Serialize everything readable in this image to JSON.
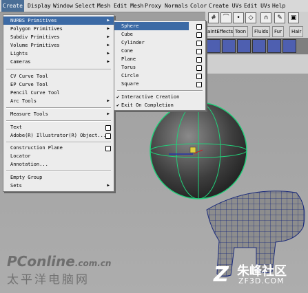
{
  "menubar": {
    "items": [
      "Create",
      "Display",
      "Window",
      "Select",
      "Mesh",
      "Edit Mesh",
      "Proxy",
      "Normals",
      "Color",
      "Create UVs",
      "Edit UVs",
      "Help"
    ]
  },
  "create_menu": {
    "items": [
      {
        "label": "NURBS Primitives",
        "arrow": true
      },
      {
        "label": "Polygon Primitives",
        "arrow": true
      },
      {
        "label": "Subdiv Primitives",
        "arrow": true
      },
      {
        "label": "Volume Primitives",
        "arrow": true
      },
      {
        "label": "Lights",
        "arrow": true
      },
      {
        "label": "Cameras",
        "arrow": true
      },
      {
        "label": "CV Curve Tool",
        "option": true
      },
      {
        "label": "EP Curve Tool",
        "option": true
      },
      {
        "label": "Pencil Curve Tool",
        "option": true
      },
      {
        "label": "Arc Tools",
        "arrow": true
      },
      {
        "label": "Measure Tools",
        "arrow": true
      },
      {
        "label": "Text",
        "option": true
      },
      {
        "label": "Adobe(R) Illustrator(R) Object...",
        "option": true
      },
      {
        "label": "Construction Plane",
        "option": true
      },
      {
        "label": "Locator"
      },
      {
        "label": "Annotation..."
      },
      {
        "label": "Empty Group"
      },
      {
        "label": "Sets",
        "arrow": true
      }
    ]
  },
  "nurbs_submenu": {
    "items": [
      "Sphere",
      "Cube",
      "Cylinder",
      "Cone",
      "Plane",
      "Torus",
      "Circle",
      "Square"
    ],
    "checks": [
      "Interactive Creation",
      "Exit On Completion"
    ]
  },
  "shelf": {
    "tabs": [
      "aintEffects",
      "Toon",
      "Fluids",
      "Fur",
      "Hair"
    ]
  },
  "watermarks": {
    "left_top": "PConline",
    "left_top_suffix": ".com.cn",
    "left_bottom": "太平洋电脑网",
    "right_top": "朱峰社区",
    "right_bottom": "ZF3D.COM"
  },
  "colors": {
    "menu_highlight": "#3c6aa5",
    "wire_green": "#22d07a",
    "wire_blue": "#1a2a7a"
  }
}
